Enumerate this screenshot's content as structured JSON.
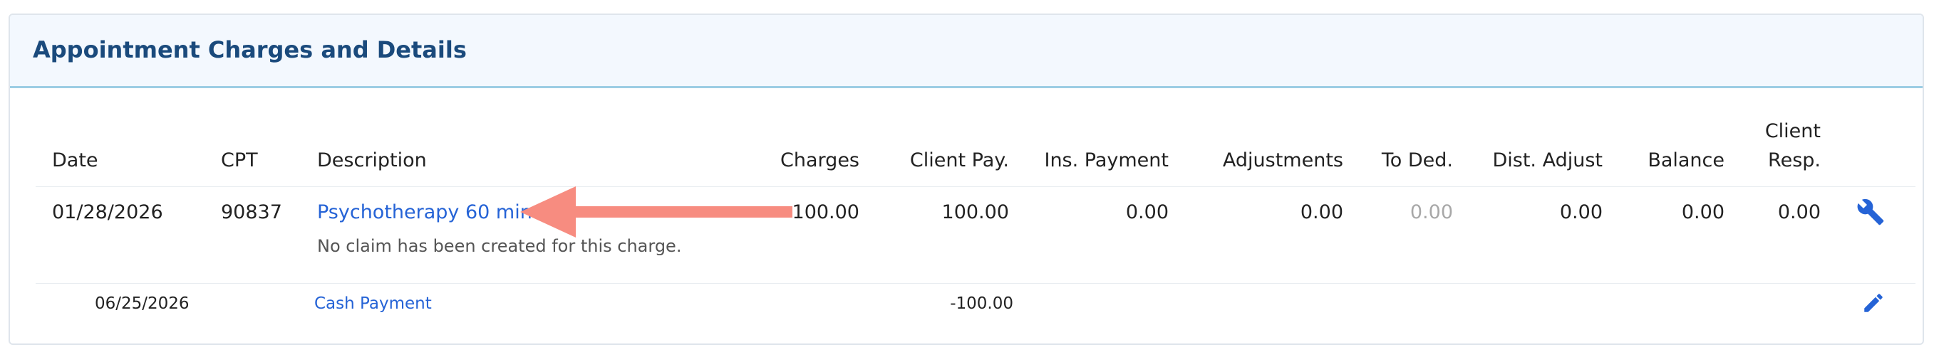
{
  "panel": {
    "title": "Appointment Charges and Details"
  },
  "columns": {
    "date": "Date",
    "cpt": "CPT",
    "description": "Description",
    "charges": "Charges",
    "client_pay": "Client Pay.",
    "ins_payment": "Ins. Payment",
    "adjustments": "Adjustments",
    "to_ded": "To Ded.",
    "dist_adjust": "Dist. Adjust",
    "balance": "Balance",
    "client_resp_line1": "Client",
    "client_resp_line2": "Resp."
  },
  "charge_row": {
    "date": "01/28/2026",
    "cpt": "90837",
    "description": "Psychotherapy 60 min",
    "note": "No claim has been created for this charge.",
    "charges": "100.00",
    "client_pay": "100.00",
    "ins_payment": "0.00",
    "adjustments": "0.00",
    "to_ded": "0.00",
    "dist_adjust": "0.00",
    "balance": "0.00",
    "client_resp": "0.00",
    "action_icon": "wrench-icon"
  },
  "payment_row": {
    "date": "06/25/2026",
    "description": "Cash Payment",
    "client_pay": "-100.00",
    "action_icon": "pencil-icon"
  },
  "colors": {
    "title": "#1a4a7c",
    "link": "#2563d6",
    "annotation_arrow": "#f78c80",
    "header_bg": "#f3f8fe",
    "header_border": "#9ccde4"
  }
}
